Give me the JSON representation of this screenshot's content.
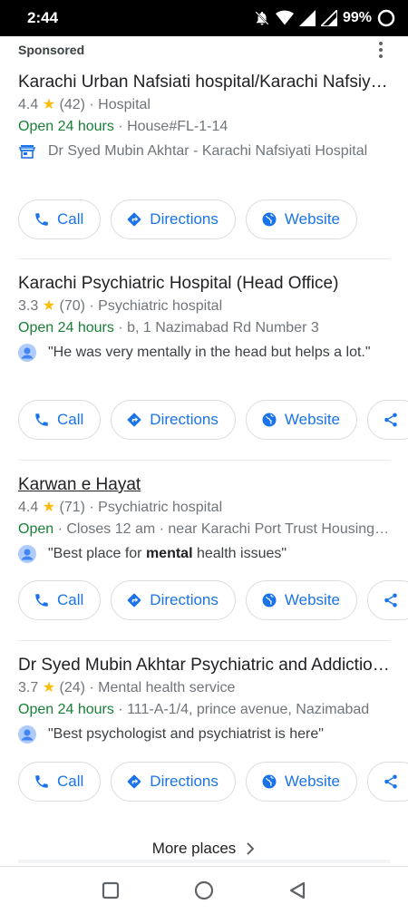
{
  "status_bar": {
    "time": "2:44",
    "battery": "99%"
  },
  "header": {
    "sponsored": "Sponsored"
  },
  "listings": [
    {
      "title": "Karachi Urban Nafsiati hospital/Karachi Nafsiyati Hospital",
      "rating": "4.4",
      "reviews": "(42)",
      "category": "Hospital",
      "hours": "Open 24 hours",
      "address": "House#FL-1-14",
      "detail": "Dr Syed Mubin Akhtar - Karachi Nafsiyati Hospital"
    },
    {
      "title": "Karachi Psychiatric Hospital (Head Office)",
      "rating": "3.3",
      "reviews": "(70)",
      "category": "Psychiatric hospital",
      "hours": "Open 24 hours",
      "address": "b, 1 Nazimabad Rd Number 3",
      "review": "\"He was very mentally in the head but helps a lot.\""
    },
    {
      "title": "Karwan e Hayat",
      "rating": "4.4",
      "reviews": "(71)",
      "category": "Psychiatric hospital",
      "hours": "Open",
      "closes": "Closes 12 am",
      "address": "near Karachi Port Trust Housing Society",
      "review_pre": "\"Best place for ",
      "review_bold": "mental",
      "review_post": " health issues\""
    },
    {
      "title": "Dr Syed Mubin Akhtar Psychiatric and Addiction Clinic",
      "rating": "3.7",
      "reviews": "(24)",
      "category": "Mental health service",
      "hours": "Open 24 hours",
      "address": "111-A-1/4, prince avenue, Nazimabad",
      "review": "\"Best psychologist and psychiatrist is here\""
    }
  ],
  "buttons": {
    "call": "Call",
    "directions": "Directions",
    "website": "Website"
  },
  "more_places": "More places",
  "colors": {
    "accent": "#1a73e8",
    "open": "#188038",
    "star": "#fbbc04"
  },
  "icons": [
    "phone-icon",
    "directions-icon",
    "globe-icon",
    "share-icon",
    "person-icon",
    "storefront-icon",
    "chevron-right-icon"
  ]
}
